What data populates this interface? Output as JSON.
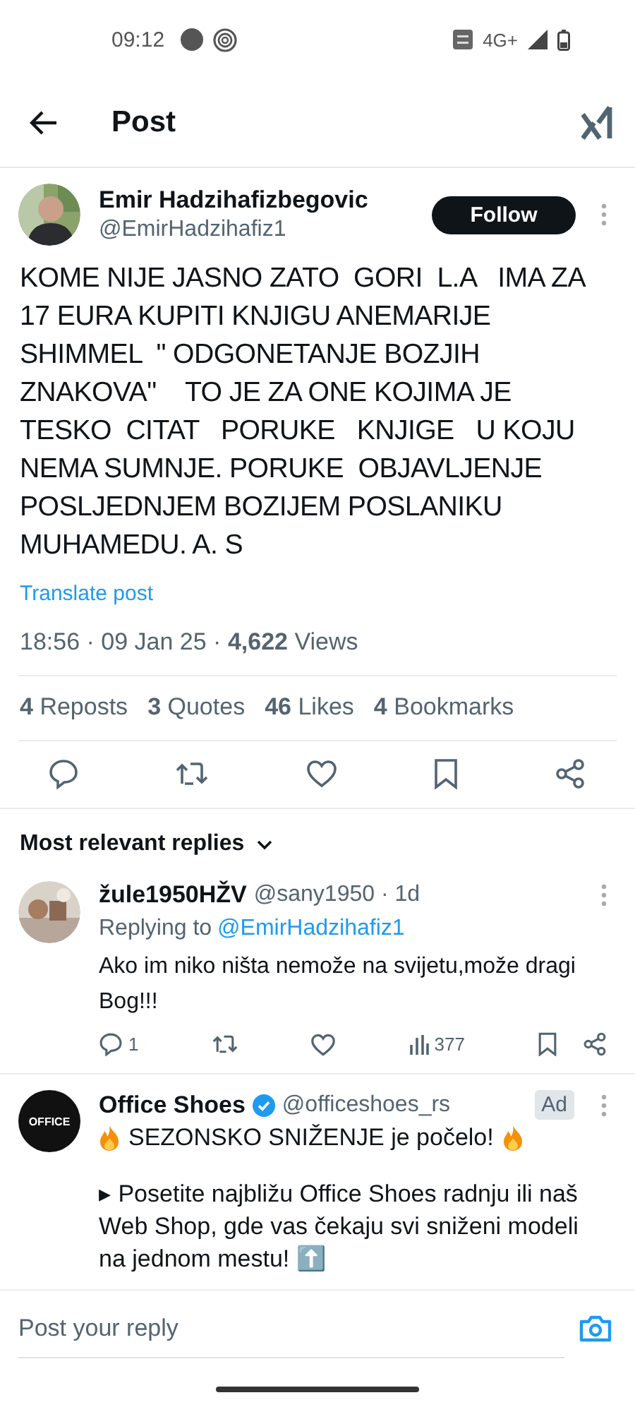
{
  "status_bar": {
    "time": "09:12",
    "network": "4G+"
  },
  "header": {
    "title": "Post"
  },
  "post": {
    "author_name": "Emir Hadzihafizbegovic",
    "handle": "@EmirHadzihafiz1",
    "follow_button": "Follow",
    "text": "KOME NIJE JASNO ZATO  GORI  L.A   IMA ZA 17 EURA KUPITI KNJIGU ANEMARIJE SHIMMEL  \" ODGONETANJE BOZJIH ZNAKOVA\"    TO JE ZA ONE KOJIMA JE TESKO  CITAT   PORUKE   KNJIGE   U KOJU NEMA SUMNJE. PORUKE  OBJAVLJENJE POSLJEDNJEM BOZIJEM POSLANIKU MUHAMEDU. A. S",
    "translate_link": "Translate post",
    "meta": "18:56 · 09 Jan 25 · **4,622** Views",
    "stats": [
      {
        "text": "**4** Reposts"
      },
      {
        "text": "**3** Quotes"
      },
      {
        "text": "**46** Likes"
      },
      {
        "text": "**4** Bookmarks"
      }
    ]
  },
  "replies_sort": {
    "label": "Most relevant replies"
  },
  "replies": [
    {
      "name": "žule1950HŽV",
      "handle": "@sany1950 · 1d",
      "replying_prefix": "Replying to",
      "replying_to": "@EmirHadzihafiz1",
      "text": "Ako im niko ništa nemože na svijetu,može dragi Bog!!!",
      "reply_count": "1",
      "views": "377"
    }
  ],
  "ad": {
    "name": "Office Shoes",
    "verified": true,
    "handle": "@officeshoes_rs",
    "badge": "Ad",
    "logo_text": "OFFICE",
    "headline": "SEZONSKO SNIŽENJE je počelo!",
    "body": "▸ Posetite najbližu Office Shoes radnju ili naš Web Shop, gde vas čekaju svi sniženi modeli na jednom mestu! ⬆️"
  },
  "reply_bar": {
    "placeholder": "Post your reply"
  }
}
